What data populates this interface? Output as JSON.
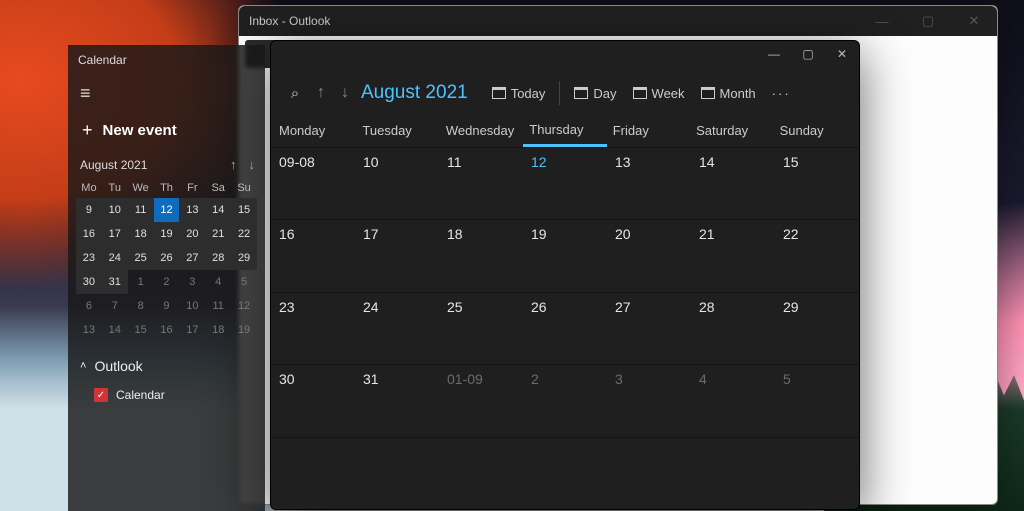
{
  "outlook": {
    "title": "Inbox - Outlook",
    "win": {
      "min": "—",
      "max": "▢",
      "close": "✕"
    }
  },
  "calendar_win": {
    "win": {
      "min": "—",
      "max": "▢",
      "close": "✕"
    },
    "toolbar": {
      "search": "⌕",
      "prev": "↑",
      "next": "↓",
      "month_year": "August 2021",
      "today": "Today",
      "day": "Day",
      "week": "Week",
      "month": "Month",
      "more": "···"
    },
    "weekdays": [
      "Monday",
      "Tuesday",
      "Wednesday",
      "Thursday",
      "Friday",
      "Saturday",
      "Sunday"
    ],
    "today_col": 3,
    "cells": [
      {
        "t": "09-08",
        "o": false
      },
      {
        "t": "10",
        "o": false
      },
      {
        "t": "11",
        "o": false
      },
      {
        "t": "12",
        "o": false,
        "today": true
      },
      {
        "t": "13",
        "o": false
      },
      {
        "t": "14",
        "o": false
      },
      {
        "t": "15",
        "o": false
      },
      {
        "t": "16",
        "o": false
      },
      {
        "t": "17",
        "o": false
      },
      {
        "t": "18",
        "o": false
      },
      {
        "t": "19",
        "o": false
      },
      {
        "t": "20",
        "o": false
      },
      {
        "t": "21",
        "o": false
      },
      {
        "t": "22",
        "o": false
      },
      {
        "t": "23",
        "o": false
      },
      {
        "t": "24",
        "o": false
      },
      {
        "t": "25",
        "o": false
      },
      {
        "t": "26",
        "o": false
      },
      {
        "t": "27",
        "o": false
      },
      {
        "t": "28",
        "o": false
      },
      {
        "t": "29",
        "o": false
      },
      {
        "t": "30",
        "o": false
      },
      {
        "t": "31",
        "o": false
      },
      {
        "t": "01-09",
        "o": true
      },
      {
        "t": "2",
        "o": true
      },
      {
        "t": "3",
        "o": true
      },
      {
        "t": "4",
        "o": true
      },
      {
        "t": "5",
        "o": true
      },
      {
        "t": "",
        "o": true
      },
      {
        "t": "",
        "o": true
      },
      {
        "t": "",
        "o": true
      },
      {
        "t": "",
        "o": true
      },
      {
        "t": "",
        "o": true
      },
      {
        "t": "",
        "o": true
      },
      {
        "t": "",
        "o": true
      }
    ]
  },
  "sidebar": {
    "title": "Calendar",
    "hamburger": "≡",
    "new_event": "New event",
    "plus": "+",
    "mini": {
      "month_year": "August 2021",
      "up": "↑",
      "down": "↓",
      "dow": [
        "Mo",
        "Tu",
        "We",
        "Th",
        "Fr",
        "Sa",
        "Su"
      ],
      "days": [
        {
          "t": "9",
          "in": true
        },
        {
          "t": "10",
          "in": true
        },
        {
          "t": "11",
          "in": true
        },
        {
          "t": "12",
          "in": true,
          "today": true
        },
        {
          "t": "13",
          "in": true
        },
        {
          "t": "14",
          "in": true
        },
        {
          "t": "15",
          "in": true
        },
        {
          "t": "16",
          "in": true
        },
        {
          "t": "17",
          "in": true
        },
        {
          "t": "18",
          "in": true
        },
        {
          "t": "19",
          "in": true
        },
        {
          "t": "20",
          "in": true
        },
        {
          "t": "21",
          "in": true
        },
        {
          "t": "22",
          "in": true
        },
        {
          "t": "23",
          "in": true
        },
        {
          "t": "24",
          "in": true
        },
        {
          "t": "25",
          "in": true
        },
        {
          "t": "26",
          "in": true
        },
        {
          "t": "27",
          "in": true
        },
        {
          "t": "28",
          "in": true
        },
        {
          "t": "29",
          "in": true
        },
        {
          "t": "30",
          "in": true
        },
        {
          "t": "31",
          "in": true
        },
        {
          "t": "1",
          "in": false
        },
        {
          "t": "2",
          "in": false
        },
        {
          "t": "3",
          "in": false
        },
        {
          "t": "4",
          "in": false
        },
        {
          "t": "5",
          "in": false
        },
        {
          "t": "6",
          "in": false
        },
        {
          "t": "7",
          "in": false
        },
        {
          "t": "8",
          "in": false
        },
        {
          "t": "9",
          "in": false
        },
        {
          "t": "10",
          "in": false
        },
        {
          "t": "11",
          "in": false
        },
        {
          "t": "12",
          "in": false
        },
        {
          "t": "13",
          "in": false
        },
        {
          "t": "14",
          "in": false
        },
        {
          "t": "15",
          "in": false
        },
        {
          "t": "16",
          "in": false
        },
        {
          "t": "17",
          "in": false
        },
        {
          "t": "18",
          "in": false
        },
        {
          "t": "19",
          "in": false
        }
      ]
    },
    "account": {
      "chevron": "˄",
      "name": "Outlook"
    },
    "calendars": [
      {
        "checked": "✓",
        "label": "Calendar"
      }
    ]
  }
}
